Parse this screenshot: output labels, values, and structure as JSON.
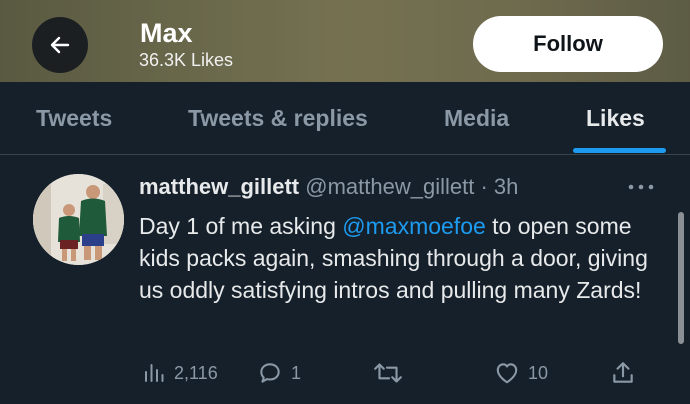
{
  "colors": {
    "background": "#15202b",
    "accent": "#1d9bf0",
    "muted": "#8b98a5",
    "text": "#e7e9ea",
    "follow_bg": "#ffffff"
  },
  "header": {
    "back_icon": "arrow-left-icon",
    "title": "Max",
    "subtitle": "36.3K Likes",
    "follow_label": "Follow"
  },
  "tabs": [
    {
      "label": "Tweets",
      "active": false
    },
    {
      "label": "Tweets & replies",
      "active": false
    },
    {
      "label": "Media",
      "active": false
    },
    {
      "label": "Likes",
      "active": true
    }
  ],
  "tweet": {
    "display_name": "matthew_gillett",
    "handle": "@matthew_gillett",
    "separator": "·",
    "time": "3h",
    "more_icon": "more-horizontal-icon",
    "text_before": "Day 1 of me asking ",
    "mention": "@maxmoefoe",
    "text_after": " to open some kids packs again, smashing through a door, giving us oddly satisfying intros and pulling many Zards!",
    "actions": {
      "views": "2,116",
      "replies": "1",
      "retweets": "",
      "likes": "10"
    },
    "action_icons": [
      "analytics-icon",
      "reply-icon",
      "retweet-icon",
      "like-heart-icon",
      "share-icon"
    ]
  }
}
